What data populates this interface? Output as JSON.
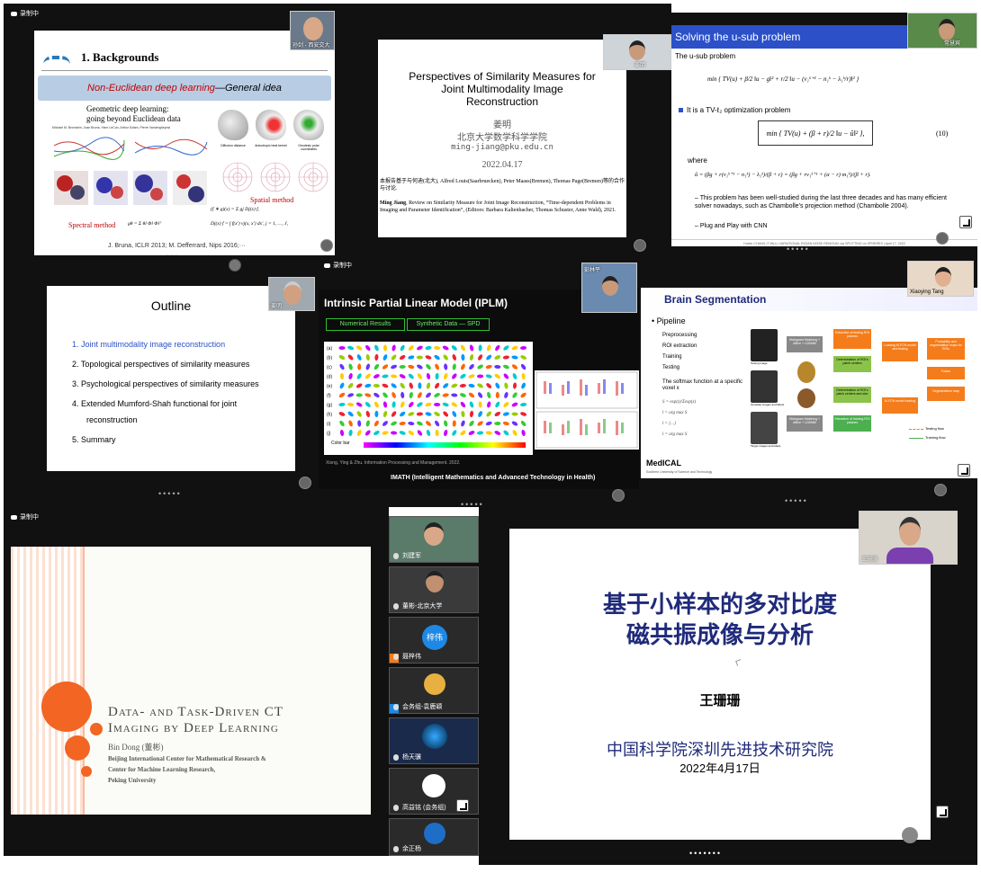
{
  "recording_label": "录制中",
  "p1": {
    "title": "1. Backgrounds",
    "banner_part1": "Non-Euclidean deep learning",
    "banner_part2": "—General idea",
    "paper_title_line1": "Geometric deep learning:",
    "paper_title_line2": "going beyond Euclidean data",
    "paper_authors": "Michael M. Bronstein, Joan Bruna, Yann LeCun, Arthur Szlam, Pierre Vandergheynst",
    "bunny_labels": [
      "Diffusion distance",
      "Anisotropic heat kernel",
      "Geodesic polar coordinates"
    ],
    "plot_labels": [
      "Spectral",
      "Spatial",
      "Spectral"
    ],
    "spectral_label": "Spectral method",
    "spatial_label": "Spatial method",
    "formula_spectral": "gθ = Σ θl Φl Φlᵀ",
    "formula_conv": "(f ∗ g)(x) = Σ gj Dj(x) f,",
    "formula_dj": "Dj(x) f = ∫ f(x′) vj(x, x′) dx′,  j = 1, …, J,",
    "citation": "J. Bruna, ICLR 2013; M. Defferrard, Nips 2016;···",
    "cam_name": "孙剑 - 西安交大"
  },
  "p2": {
    "title_line1": "Perspectives of Similarity Measures for",
    "title_line2": "Joint Multimodality Image",
    "title_line3": "Reconstruction",
    "author": "姜明",
    "affiliation": "北京大学数学科学学院",
    "email": "ming-jiang@pku.edu.cn",
    "date": "2022.04.17",
    "collab": "本报告基于与何迪(北大), Alfred Louis(Saarbruecken), Peter Maass(Bremen), Thomas Page(Bremen)等的合作与讨论.",
    "ref_author": "Ming Jiang",
    "ref_text": ", Review on Similarity Measure for Joint Image Reconstruction, “Time-dependent Problems in Imaging and Parameter Identification”, (Editors: Barbara Kaltenbacher, Thomas Schuster, Anne Wald), 2021.",
    "cam_name": "姜明"
  },
  "p3": {
    "title": "Solving the u-sub problem",
    "intro": "The u-sub problem",
    "eq1": "min { TV(u) + β/2 ‖u − g‖² + r/2 ‖u − (v₁ᵏ⁺¹ − n₁ᵏ − λ₁ᵏ/r)‖² }",
    "bullet1": "It is a TV-ℓ₂ optimization problem",
    "eq2": "min { TV(u) + (β + r)/2 ‖u − û‖² },",
    "eq2_num": "(10)",
    "where": "where",
    "eq3": "û = (βg + r(v₁ᵏ⁺¹ − n₁ᵏ) − λ₁ᵏ)/(β + r) = (βg + rv₁ᵏ⁺¹ + (α − r) m₁ᵏ)/(β + r).",
    "sub1": "This problem has been well-studied during the last three decades and has many efficient solver nowadays, such as Chambolle’s projection method (Chambolle 2004).",
    "sub2": "Plug and Play with CNN",
    "footer": "Huibin CHANG (TJNU)  |  VARIATIONAL RICIAN NOISE REMOVAL via SPLITTING on SPHERES  |  April 17, 2022",
    "cam_name": "常慧宾"
  },
  "p4": {
    "title": "Outline",
    "items": [
      "1.  Joint multimodality image reconstruction",
      "2.  Topological perspectives of similarity measures",
      "3.  Psychological perspectives of similarity measures",
      "4.  Extended Mumford-Shah functional for joint",
      "reconstruction",
      "5.  Summary"
    ],
    "cam_name": "姜明"
  },
  "p5": {
    "title": "Intrinsic Partial Linear Model (IPLM)",
    "tab1": "Numerical Results",
    "tab2": "Synthetic Data — SPD",
    "row_labels": [
      "(a)",
      "(b)",
      "(c)",
      "(d)",
      "(e)",
      "(f)",
      "(g)",
      "(h)",
      "(i)",
      "(j)"
    ],
    "colorbar_label": "Color bar",
    "citation": "Xiong, Ying & Zhu. Information Processing and Management. 2022.",
    "footer": "IMATH (Intelligent Mathematics and Advanced Technology in Health)",
    "cam_name": "彭林平"
  },
  "p6": {
    "title": "Brain Segmentation",
    "pipeline": "Pipeline",
    "steps": [
      "Preprocessing",
      "ROI extraction",
      "Training",
      "Testing"
    ],
    "softmax": "The softmax function at a specific voxel x",
    "boxes": [
      "Histogram Matching + Affine + LDDMM",
      "Extraction of testing ROI patches",
      "Determination of ROI's patch centers",
      "Determination of ROI's patch centers and size",
      "Extraction of training ROI patches",
      "Loading M-FCN model and testing",
      "M-FCN model training",
      "Histogram Matching + Affine + LDDMM",
      "Probability and segmentation maps for ROIs",
      "Fusion",
      "Segmentation map"
    ],
    "legend1": "Testing flow",
    "legend2": "Training flow",
    "images_labels": [
      "Testing image",
      "Template images and labels",
      "Target images and labels"
    ],
    "brand": "MedICAL",
    "brand_sub": "Southern University of Science and Technology",
    "cam_name": "Xiaoying Tang"
  },
  "p7": {
    "title_line1": "Data- and Task-Driven CT",
    "title_line2": "Imaging by Deep Learning",
    "author": "Bin Dong (董彬)",
    "aff1": "Beijing International Center for Mathematical Research &",
    "aff2": "Center for Machine Learning Research,",
    "aff3": "Peking University"
  },
  "gallery": {
    "tiles": [
      "刘建军",
      "董彬-北京大学",
      "聂梓伟",
      "会务组-袁鹿颖",
      "杨天骥",
      "高益铭 (会务组)",
      "余正杨"
    ],
    "avatar_text": "梓伟"
  },
  "p8": {
    "title_line1": "基于小样本的多对比度",
    "title_line2": "磁共振成像与分析",
    "author": "王珊珊",
    "institute": "中国科学院深圳先进技术研究院",
    "date": "2022年4月17日",
    "cam_name": "王珊珊"
  },
  "colors": {
    "navy_title": "#1f2a7a",
    "blue_header": "#2b50c8",
    "banner_blue": "#b8cce4",
    "red": "#c00000",
    "orange": "#f26522",
    "green_bar": "#1e7a3c"
  }
}
